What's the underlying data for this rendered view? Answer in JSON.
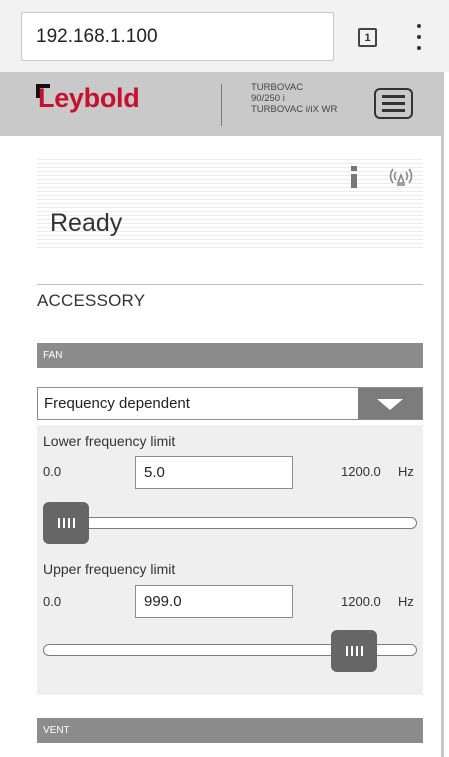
{
  "browser": {
    "url": "192.168.1.100",
    "tab_count": "1"
  },
  "header": {
    "logo_text": "Leybold",
    "model_lines": [
      "TURBOVAC",
      "90/250 i",
      "TURBOVAC i/iX WR"
    ]
  },
  "status": {
    "state": "Ready"
  },
  "section": {
    "title": "ACCESSORY"
  },
  "fan": {
    "group_label": "FAN",
    "mode": "Frequency dependent",
    "lower": {
      "label": "Lower frequency limit",
      "min": "0.0",
      "value": "5.0",
      "max": "1200.0",
      "unit": "Hz",
      "slider_fraction": 0.004
    },
    "upper": {
      "label": "Upper frequency limit",
      "min": "0.0",
      "value": "999.0",
      "max": "1200.0",
      "unit": "Hz",
      "slider_fraction": 0.8325
    }
  },
  "vent": {
    "group_label": "VENT"
  },
  "colors": {
    "brand_red": "#c8102e",
    "header_bg": "#c9c9c9",
    "group_bar": "#8c8c8c",
    "handle": "#666666"
  }
}
